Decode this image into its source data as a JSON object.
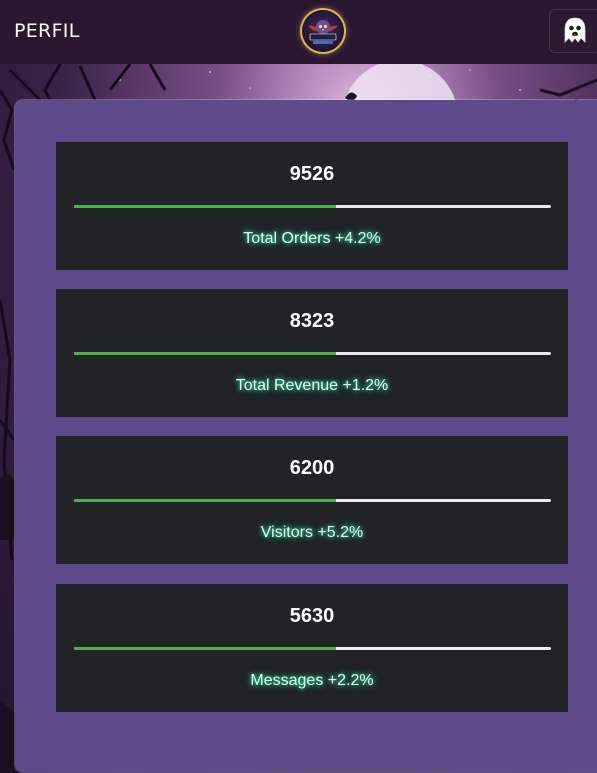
{
  "header": {
    "title": "PERFIL",
    "logo_icon": "twitch-gamers-logo",
    "profile_icon": "ghost-icon"
  },
  "colors": {
    "header_bg": "#2b1732",
    "panel_bg": "#5e4b8b",
    "card_bg": "#212327",
    "progress_fill": "#4cae4c",
    "progress_track": "#ececec",
    "label_glow": "#33e0a0"
  },
  "stats": [
    {
      "value": "9526",
      "label": "Total Orders +4.2%",
      "progress": 0.55
    },
    {
      "value": "8323",
      "label": "Total Revenue +1.2%",
      "progress": 0.55
    },
    {
      "value": "6200",
      "label": "Visitors +5.2%",
      "progress": 0.55
    },
    {
      "value": "5630",
      "label": "Messages +2.2%",
      "progress": 0.55
    }
  ]
}
